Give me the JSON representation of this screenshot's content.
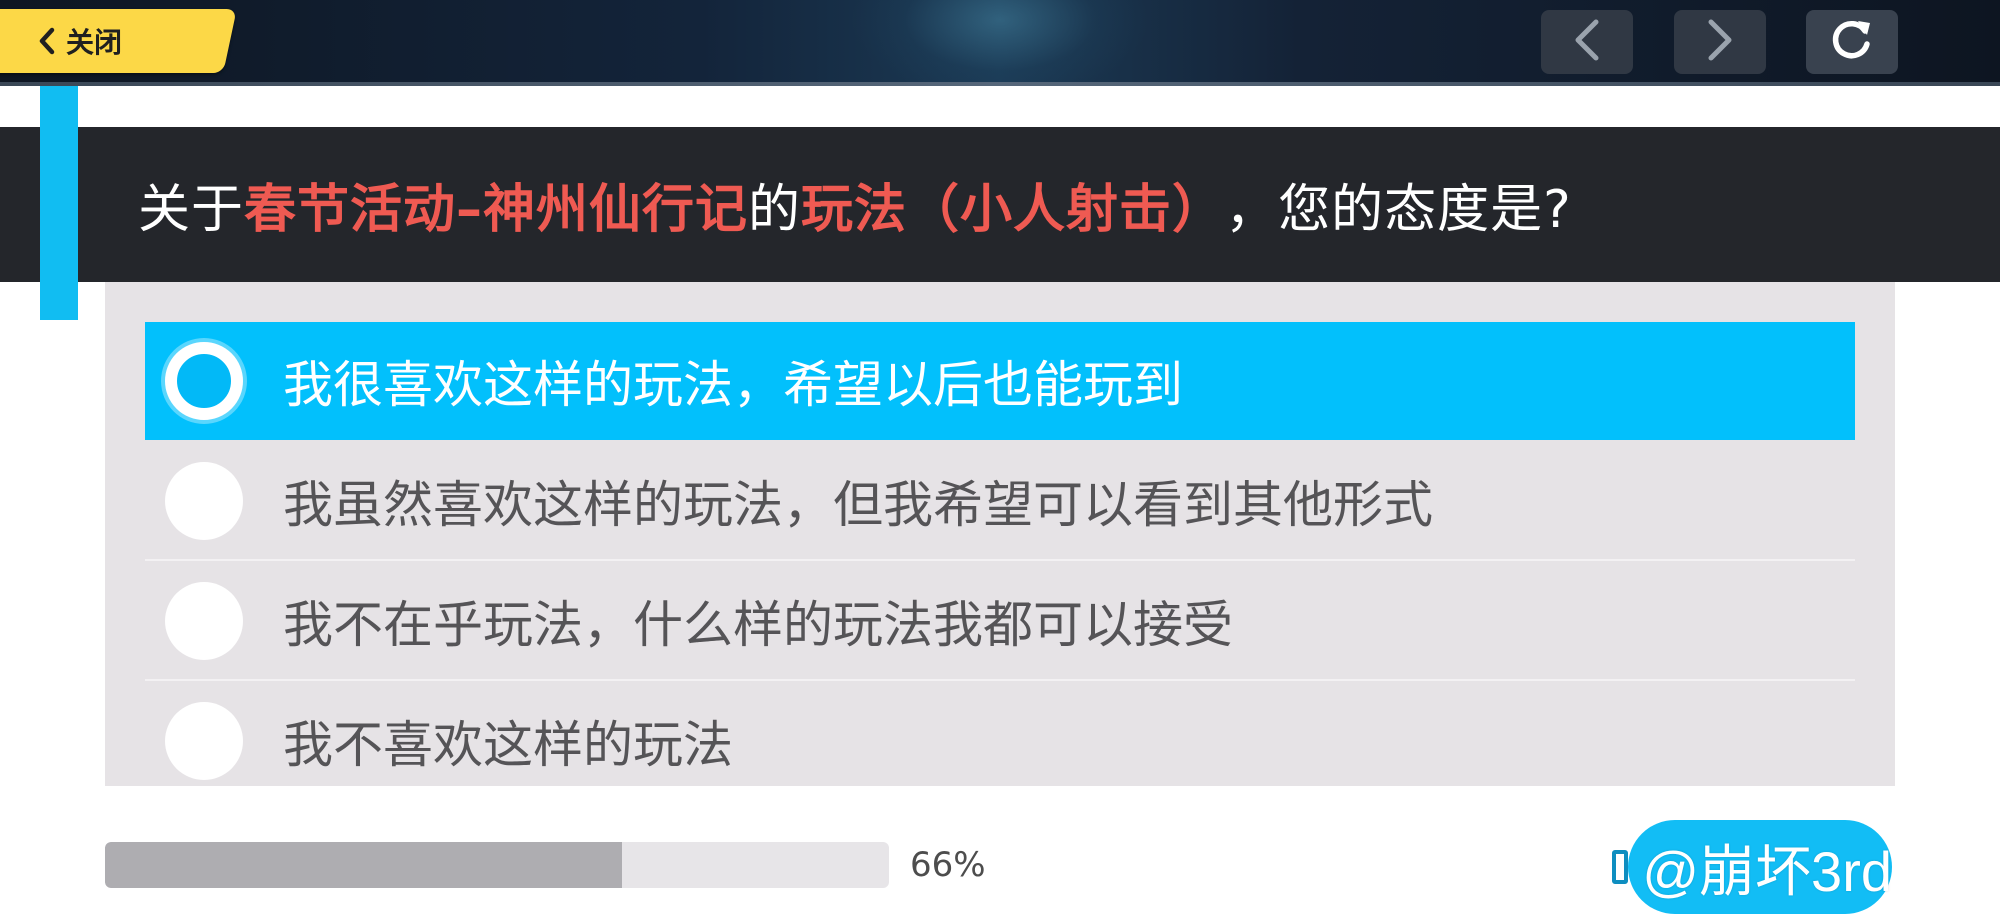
{
  "topbar": {
    "close_label": "关闭",
    "close_icon": "chevron-left-icon",
    "prev_icon": "chevron-left-icon",
    "next_icon": "chevron-right-icon",
    "refresh_icon": "refresh-icon"
  },
  "question": {
    "parts": [
      {
        "text": "关于",
        "highlight": false
      },
      {
        "text": "春节活动–神州仙行记",
        "highlight": true
      },
      {
        "text": "的",
        "highlight": false
      },
      {
        "text": "玩法（小人射击）",
        "highlight": true
      },
      {
        "text": "，您的态度是?",
        "highlight": false
      }
    ]
  },
  "options": [
    {
      "label": "我很喜欢这样的玩法，希望以后也能玩到",
      "selected": true
    },
    {
      "label": "我虽然喜欢这样的玩法，但我希望可以看到其他形式",
      "selected": false
    },
    {
      "label": "我不在乎玩法，什么样的玩法我都可以接受",
      "selected": false
    },
    {
      "label": "我不喜欢这样的玩法",
      "selected": false
    }
  ],
  "progress": {
    "fraction": 0.66,
    "label": "66%"
  },
  "watermark": {
    "text": "@崩坏3rd"
  },
  "colors": {
    "accent": "#02c0fc",
    "highlight_text": "#ef5a52",
    "close_button": "#fcd847",
    "question_bg": "#24262b"
  }
}
